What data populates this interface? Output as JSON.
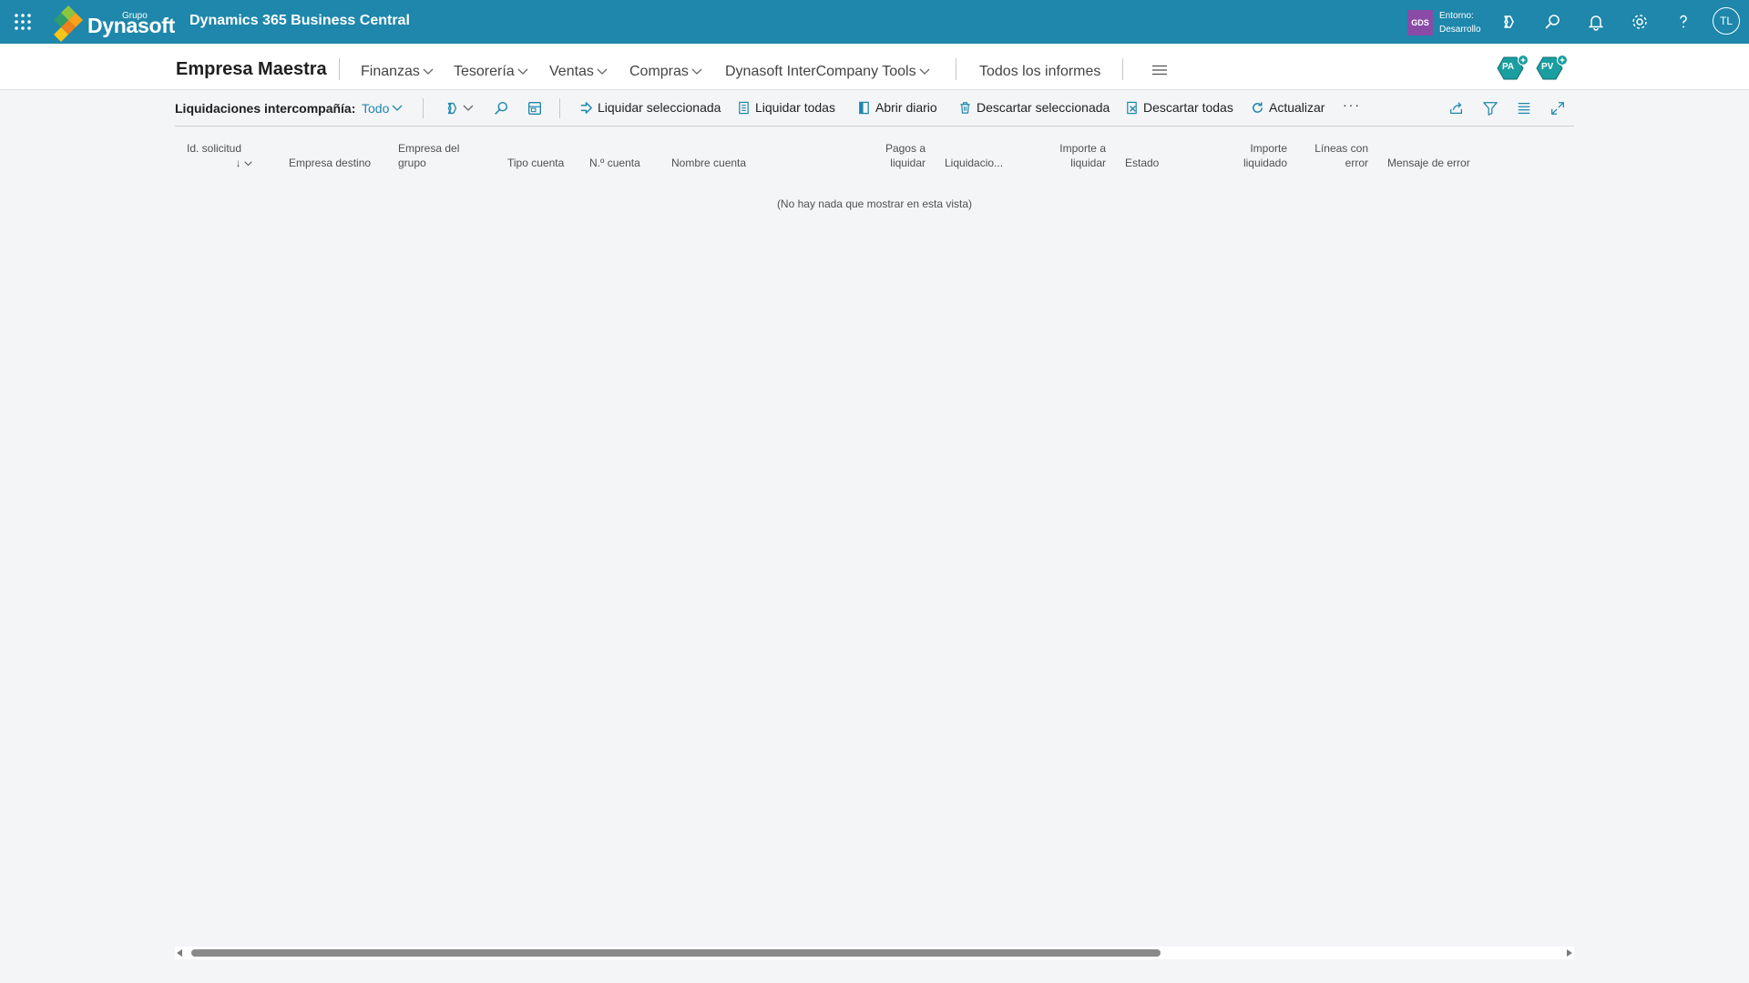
{
  "appbar": {
    "logo_small": "Grupo",
    "logo_big": "Dynasoft",
    "product": "Dynamics 365 Business Central",
    "env_badge": "GDS",
    "env_label": "Entorno:",
    "env_value": "Desarrollo",
    "avatar": "TL",
    "icons": [
      "waffle-icon",
      "copilot-icon",
      "search-icon",
      "bell-icon",
      "gear-icon",
      "help-icon"
    ]
  },
  "nav": {
    "company": "Empresa Maestra",
    "items": [
      {
        "label": "Finanzas"
      },
      {
        "label": "Tesorería"
      },
      {
        "label": "Ventas"
      },
      {
        "label": "Compras"
      },
      {
        "label": "Dynasoft InterCompany Tools"
      }
    ],
    "reports": "Todos los informes",
    "badges": [
      "PA",
      "PV"
    ]
  },
  "actionbar": {
    "title": "Liquidaciones intercompañía:",
    "view": "Todo",
    "buttons": [
      {
        "label": "Liquidar seleccionada",
        "icon": "arrow-icon"
      },
      {
        "label": "Liquidar todas",
        "icon": "document-icon"
      },
      {
        "label": "Abrir diario",
        "icon": "journal-icon"
      },
      {
        "label": "Descartar seleccionada",
        "icon": "trash-icon"
      },
      {
        "label": "Descartar todas",
        "icon": "discard-icon"
      },
      {
        "label": "Actualizar",
        "icon": "refresh-icon"
      }
    ],
    "more": "···"
  },
  "grid": {
    "columns": [
      {
        "l1": "Id. solicitud",
        "l2": "↓"
      },
      {
        "l1": "",
        "l2": "Empresa destino"
      },
      {
        "l1": "Empresa del",
        "l2": "grupo"
      },
      {
        "l1": "",
        "l2": "Tipo cuenta"
      },
      {
        "l1": "",
        "l2": "N.º cuenta"
      },
      {
        "l1": "",
        "l2": "Nombre cuenta"
      },
      {
        "l1": "Pagos a",
        "l2": "liquidar"
      },
      {
        "l1": "",
        "l2": "Liquidacio..."
      },
      {
        "l1": "Importe a",
        "l2": "liquidar"
      },
      {
        "l1": "",
        "l2": "Estado"
      },
      {
        "l1": "Importe",
        "l2": "liquidado"
      },
      {
        "l1": "Líneas con",
        "l2": "error"
      },
      {
        "l1": "",
        "l2": "Mensaje de error"
      }
    ],
    "empty_message": "(No hay nada que mostrar en esta vista)"
  }
}
